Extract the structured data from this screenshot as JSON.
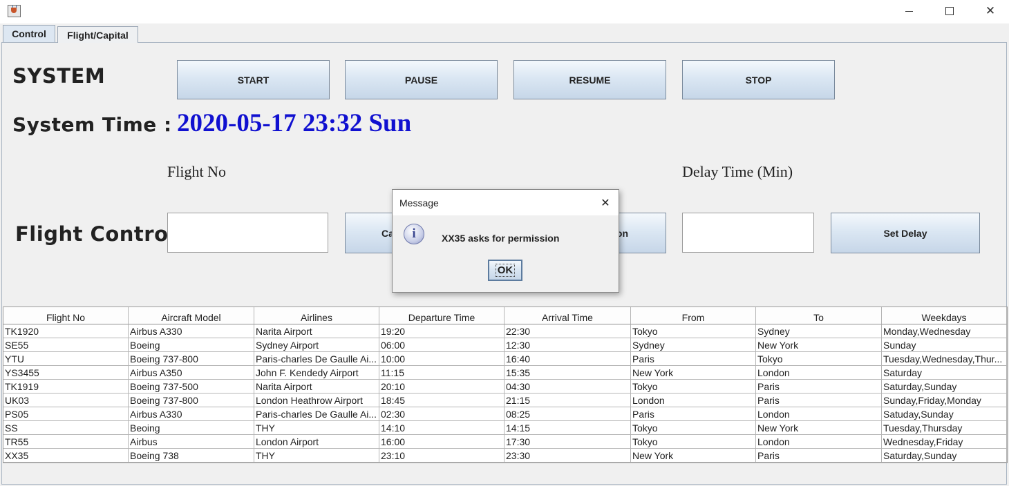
{
  "window": {
    "title": ""
  },
  "tabs": [
    {
      "label": "Control",
      "active": true
    },
    {
      "label": "Flight/Capital",
      "active": false
    }
  ],
  "system": {
    "heading": "SYSTEM",
    "buttons": {
      "start": "START",
      "pause": "PAUSE",
      "resume": "RESUME",
      "stop": "STOP"
    },
    "time_label": "System Time :",
    "time_value": "2020-05-17 23:32 Sun",
    "time_color": "#1010d0"
  },
  "flight_control": {
    "heading": "Flight Control",
    "flight_no_label": "Flight No",
    "flight_no_value": "",
    "left_button_visible": "Ca",
    "right_button_visible": "on",
    "delay_label": "Delay Time (Min)",
    "delay_value": "",
    "set_delay": "Set Delay"
  },
  "table": {
    "columns": [
      "Flight No",
      "Aircraft Model",
      "Airlines",
      "Departure Time",
      "Arrival Time",
      "From",
      "To",
      "Weekdays"
    ],
    "rows": [
      [
        "TK1920",
        "Airbus A330",
        "Narita Airport",
        "19:20",
        "22:30",
        "Tokyo",
        "Sydney",
        "Monday,Wednesday"
      ],
      [
        "SE55",
        "Boeing",
        "Sydney Airport",
        "06:00",
        "12:30",
        "Sydney",
        "New York",
        "Sunday"
      ],
      [
        "YTU",
        "Boeing 737-800",
        "Paris-charles De Gaulle Ai...",
        "10:00",
        "16:40",
        "Paris",
        "Tokyo",
        "Tuesday,Wednesday,Thur..."
      ],
      [
        "YS3455",
        "Airbus A350",
        "John F. Kendedy Airport",
        "11:15",
        "15:35",
        "New York",
        "London",
        "Saturday"
      ],
      [
        "TK1919",
        "Boeing 737-500",
        "Narita Airport",
        "20:10",
        "04:30",
        "Tokyo",
        "Paris",
        "Saturday,Sunday"
      ],
      [
        "UK03",
        "Boeing 737-800",
        "London Heathrow Airport",
        "18:45",
        "21:15",
        "London",
        "Paris",
        "Sunday,Friday,Monday"
      ],
      [
        "PS05",
        "Airbus A330",
        "Paris-charles De Gaulle Ai...",
        "02:30",
        "08:25",
        "Paris",
        "London",
        "Satuday,Sunday"
      ],
      [
        "SS",
        "Beoing",
        "THY",
        "14:10",
        "14:15",
        "Tokyo",
        "New York",
        "Tuesday,Thursday"
      ],
      [
        "TR55",
        "Airbus",
        "London Airport",
        "16:00",
        "17:30",
        "Tokyo",
        "London",
        "Wednesday,Friday"
      ],
      [
        "XX35",
        "Boeing 738",
        "THY",
        "23:10",
        "23:30",
        "New York",
        "Paris",
        "Saturday,Sunday"
      ]
    ]
  },
  "dialog": {
    "title": "Message",
    "icon": "info-icon",
    "message": "XX35 asks for permission",
    "ok": "OK"
  },
  "icons": {
    "app": "java-cup-icon",
    "minimize": "minimize-icon",
    "maximize": "maximize-icon",
    "close": "close-icon"
  }
}
